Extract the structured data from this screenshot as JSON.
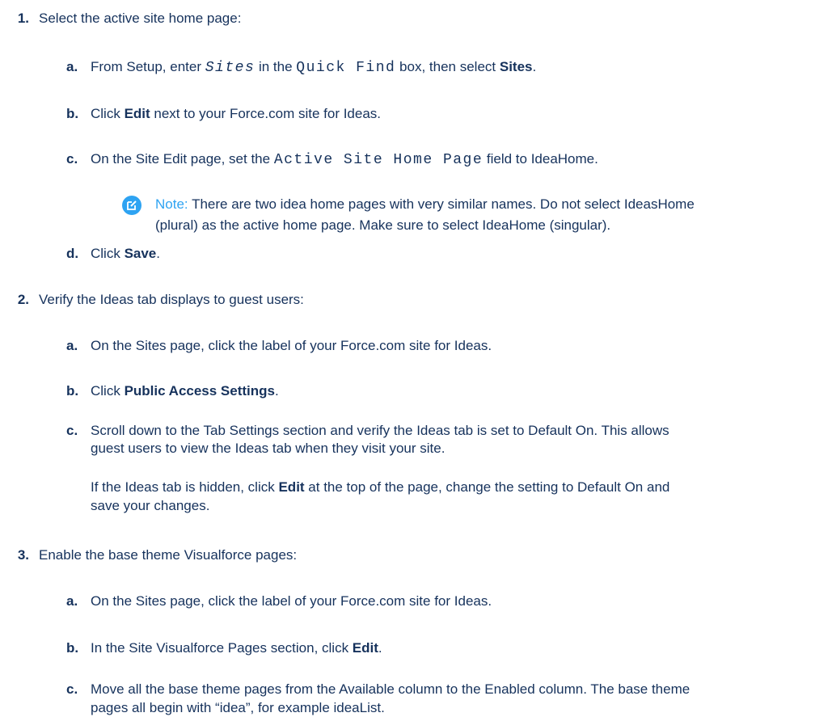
{
  "step1": {
    "number": "1.",
    "text": "Select the active site home page:",
    "a": {
      "label": "a.",
      "t1": "From Setup, enter ",
      "code1": "Sites",
      "t2": " in the ",
      "code2": "Quick Find",
      "t3": " box, then select ",
      "bold": "Sites",
      "t4": "."
    },
    "b": {
      "label": "b.",
      "t1": "Click ",
      "bold": "Edit",
      "t2": " next to your Force.com site for Ideas."
    },
    "c": {
      "label": "c.",
      "t1": "On the Site Edit page, set the ",
      "code": "Active Site Home Page",
      "t2": " field to IdeaHome."
    },
    "note": {
      "label": "Note:",
      "line1": "There are two idea home pages with very similar names. Do not select IdeasHome",
      "line2": "(plural) as the active home page. Make sure to select IdeaHome (singular)."
    },
    "d": {
      "label": "d.",
      "t1": "Click ",
      "bold": "Save",
      "t2": "."
    }
  },
  "step2": {
    "number": "2.",
    "text": "Verify the Ideas tab displays to guest users:",
    "a": {
      "label": "a.",
      "text": "On the Sites page, click the label of your Force.com site for Ideas."
    },
    "b": {
      "label": "b.",
      "t1": "Click ",
      "bold": "Public Access Settings",
      "t2": "."
    },
    "c": {
      "label": "c.",
      "line1": "Scroll down to the Tab Settings section and verify the Ideas tab is set to Default On. This allows",
      "line2": "guest users to view the Ideas tab when they visit your site."
    },
    "c_extra": {
      "t1": "If the Ideas tab is hidden, click ",
      "bold": "Edit",
      "t2": " at the top of the page, change the setting to Default On and",
      "line2": "save your changes."
    }
  },
  "step3": {
    "number": "3.",
    "text": "Enable the base theme Visualforce pages:",
    "a": {
      "label": "a.",
      "text": "On the Sites page, click the label of your Force.com site for Ideas."
    },
    "b": {
      "label": "b.",
      "t1": "In the Site Visualforce Pages section, click ",
      "bold": "Edit",
      "t2": "."
    },
    "c": {
      "label": "c.",
      "line1": "Move all the base theme pages from the Available column to the Enabled column. The base theme",
      "line2": "pages all begin with “idea”, for example ideaList."
    }
  }
}
